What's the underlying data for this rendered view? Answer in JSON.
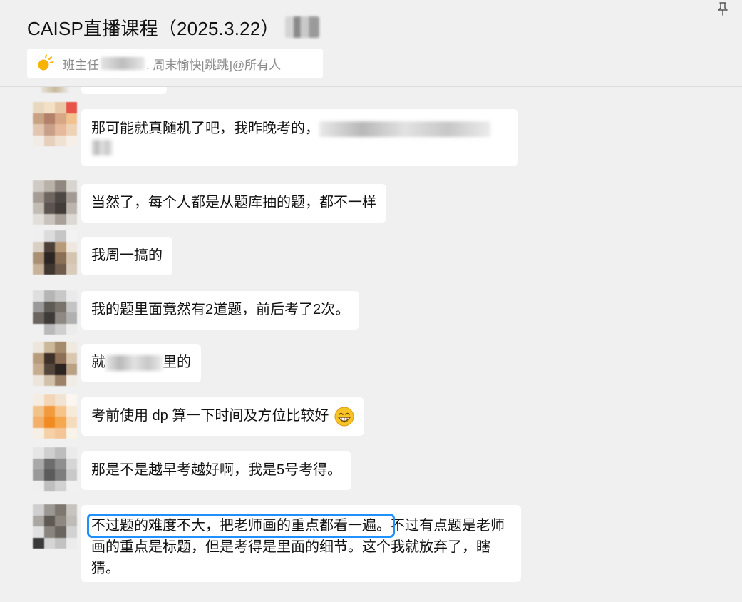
{
  "window": {
    "title": "CAISP直播课程（2025.3.22）",
    "pin_icon": "pin-icon"
  },
  "announcement": {
    "icon": "sun-icon",
    "prefix": "班主任",
    "suffix": ". 周末愉快[跳跳]@所有人"
  },
  "messages": [
    {
      "text": "那可能就真随机了吧，我昨晚考的，",
      "avatar_colors": [
        "#e9d8c0",
        "#f3e0c5",
        "#e7c9a8",
        "#e8534a",
        "#c9a282",
        "#b3806a",
        "#d7a684",
        "#f2c28e",
        "#e2c6b0",
        "#c8a08a",
        "#e5b99b",
        "#eed2b5",
        "#f1ede6",
        "#e6d0bc",
        "#efe2d2",
        "#f6efe7"
      ]
    },
    {
      "text": "当然了，每个人都是从题库抽的题，都不一样",
      "avatar_colors": [
        "#cfcac4",
        "#b9b2a9",
        "#8f8780",
        "#d8d5d0",
        "#a59c95",
        "#6f6660",
        "#4d4844",
        "#a39b93",
        "#c3bcb5",
        "#5c5450",
        "#433d3a",
        "#bcb5ae",
        "#e2dfdb",
        "#c9c3bd",
        "#a8a099",
        "#dcd8d3"
      ]
    },
    {
      "text": "我周一搞的",
      "avatar_colors": [
        "#efefef",
        "#dcdcdc",
        "#c6c6c6",
        "#f3f3f3",
        "#d9cfc2",
        "#4c4038",
        "#b69a7a",
        "#efe7dd",
        "#a98f74",
        "#2c2623",
        "#8a6f55",
        "#d4c4b0",
        "#c7b29a",
        "#3f3630",
        "#6f5c4c",
        "#d8cbbb"
      ]
    },
    {
      "text": "我的题里面竟然有2道题，前后考了2次。",
      "avatar_colors": [
        "#dedede",
        "#b5b5b5",
        "#c8c8c8",
        "#eaeaea",
        "#9a9a9a",
        "#5e5a56",
        "#7a736c",
        "#c4c4c4",
        "#6a655f",
        "#3f3b38",
        "#8f8983",
        "#b0b0b0",
        "#f0f0f0",
        "#b9b9b9",
        "#cfcfcf",
        "#ececec"
      ]
    },
    {
      "text_before": "就",
      "text_after": "里的",
      "avatar_colors": [
        "#ece6dc",
        "#cbb79a",
        "#a78b6d",
        "#efe9e0",
        "#b79c7c",
        "#3e3129",
        "#8c6f55",
        "#d9c7b0",
        "#c6ad8f",
        "#55463b",
        "#2b2420",
        "#b9a186",
        "#ebe5dc",
        "#d2c1aa",
        "#9c8268",
        "#f1ece4"
      ]
    },
    {
      "text": "考前使用 dp 算一下时间及方位比较好",
      "emoji": "grinning-face-icon",
      "avatar_colors": [
        "#f6ede2",
        "#f3d6b6",
        "#f2e4d2",
        "#fbf6f0",
        "#f1c28a",
        "#f39a3c",
        "#f6c488",
        "#f8ead9",
        "#f3b06a",
        "#f28a22",
        "#f5a84e",
        "#f6dcbc",
        "#f8efe4",
        "#f6d1a6",
        "#f4c596",
        "#faf3ea"
      ]
    },
    {
      "text": "那是不是越早考越好啊，我是5号考得。",
      "avatar_colors": [
        "#e6e6e6",
        "#cfcfcf",
        "#bdbdbd",
        "#ebebeb",
        "#a9a9a9",
        "#6d6d6d",
        "#8e8e8e",
        "#d6d6d6",
        "#9a9a9a",
        "#5b5b5b",
        "#7d7d7d",
        "#c9c9c9",
        "#efefef",
        "#bfbfbf",
        "#d2d2d2",
        "#f1f1f1"
      ]
    },
    {
      "highlighted": "不过题的难度不大，把老师画的重点都看一遍。",
      "text": "不过有点题是老师画的重点是标题，但是考得是里面的细节。这个我就放弃了，瞎猜。",
      "avatar_colors": [
        "#cfcfcf",
        "#9b9893",
        "#7d7770",
        "#c7c4c0",
        "#aaa6a1",
        "#5f5953",
        "#8d8780",
        "#bfbcb8",
        "#e0e0e0",
        "#8a847e",
        "#6b655f",
        "#d2d2d2",
        "#3a3a3a",
        "#d5d5d5",
        "#c2c2c2",
        "#ececec"
      ]
    }
  ]
}
